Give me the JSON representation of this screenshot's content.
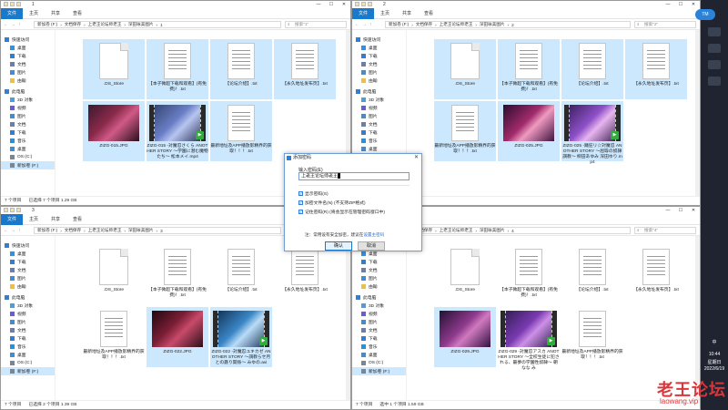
{
  "windows": [
    {
      "title": "1",
      "tabs": [
        "文件",
        "主页",
        "共享",
        "查看"
      ],
      "breadcrumb": [
        "新加卷 (F:)",
        "文档保存",
        "上老王论坛师老王",
        "深田咏美图片",
        "1"
      ],
      "search_placeholder": "搜索\"1\"",
      "status": [
        "7 个项目",
        "已选择 7 个项目 1.29 GB"
      ],
      "nav": [
        {
          "label": "快速访问",
          "icon": "star-icon"
        },
        {
          "label": "桌面",
          "icon": "desktop-icon"
        },
        {
          "label": "下载",
          "icon": "download-icon"
        },
        {
          "label": "文档",
          "icon": "document-icon"
        },
        {
          "label": "图片",
          "icon": "picture-icon"
        },
        {
          "label": "由翰",
          "icon": "folder-icon"
        },
        {
          "label": "此电脑",
          "icon": "computer-icon"
        },
        {
          "label": "3D 对象",
          "icon": "cube-icon"
        },
        {
          "label": "视频",
          "icon": "video-icon"
        },
        {
          "label": "图片",
          "icon": "picture-icon"
        },
        {
          "label": "文档",
          "icon": "document-icon"
        },
        {
          "label": "下载",
          "icon": "download-icon"
        },
        {
          "label": "音乐",
          "icon": "music-icon"
        },
        {
          "label": "桌面",
          "icon": "desktop-icon"
        },
        {
          "label": "OS (C:)",
          "icon": "drive-icon"
        },
        {
          "label": "新加卷 (F:)",
          "icon": "drive-icon",
          "selected": true
        }
      ],
      "items": [
        {
          "label": ".DS_Store",
          "type": "doc",
          "selected": true
        },
        {
          "label": "【本子微超下载和观看】(有免费)！.txt",
          "type": "txt",
          "selected": true
        },
        {
          "label": "【论坛介绍】.txt",
          "type": "txt",
          "selected": true
        },
        {
          "label": "【永久地址发布页】.txt",
          "type": "txt",
          "selected": true
        },
        {
          "label": "ZIZG-015.JPG",
          "type": "pic",
          "selected": true
        },
        {
          "label": "ZIZG-015 -对魔忍さくら ANOTHER STORY ～学園に潜む魔物たち～ 松本メイ.mp4",
          "type": "vid",
          "selected": true
        },
        {
          "label": "最新地址及APP播放影精界的获取！！！.txt",
          "type": "txt",
          "selected": true
        }
      ]
    },
    {
      "title": "2",
      "tabs": [
        "文件",
        "主页",
        "共享",
        "查看"
      ],
      "breadcrumb": [
        "新加卷 (F:)",
        "文档保存",
        "上老王论坛师老王",
        "深田咏美图片",
        "2"
      ],
      "search_placeholder": "搜索\"2\"",
      "status": [
        "7 个项目",
        "已选择 7 个项目"
      ],
      "nav": [
        {
          "label": "快速访问",
          "icon": "star-icon"
        },
        {
          "label": "桌面",
          "icon": "desktop-icon"
        },
        {
          "label": "下载",
          "icon": "download-icon"
        },
        {
          "label": "文档",
          "icon": "document-icon"
        },
        {
          "label": "图片",
          "icon": "picture-icon"
        },
        {
          "label": "由翰",
          "icon": "folder-icon"
        },
        {
          "label": "此电脑",
          "icon": "computer-icon"
        },
        {
          "label": "3D 对象",
          "icon": "cube-icon"
        },
        {
          "label": "视频",
          "icon": "video-icon"
        },
        {
          "label": "图片",
          "icon": "picture-icon"
        },
        {
          "label": "文档",
          "icon": "document-icon"
        },
        {
          "label": "下载",
          "icon": "download-icon"
        },
        {
          "label": "音乐",
          "icon": "music-icon"
        },
        {
          "label": "桌面",
          "icon": "desktop-icon"
        },
        {
          "label": "OS (C:)",
          "icon": "drive-icon"
        },
        {
          "label": "新加卷 (F:)",
          "icon": "drive-icon",
          "selected": true
        }
      ],
      "items": [
        {
          "label": ".DS_Store",
          "type": "doc",
          "selected": true
        },
        {
          "label": "【本子微超下载和观看】(有免费)！.txt",
          "type": "txt",
          "selected": true
        },
        {
          "label": "【论坛介绍】.txt",
          "type": "txt",
          "selected": true
        },
        {
          "label": "【永久地址发布页】.txt",
          "type": "txt",
          "selected": true
        },
        {
          "label": "最新地址及APP播放影精界的获取！！！.txt",
          "type": "txt",
          "selected": true
        },
        {
          "label": "ZIZG-025.JPG",
          "type": "pic",
          "selected": true
        },
        {
          "label": "ZIZG-025 -踊狂リ☆対魔忍 ANOTHER STORY ～屈辱の奴隷調教～ 柳田あゆみ 深田ゆり.mp4",
          "type": "vid",
          "selected": true
        }
      ]
    },
    {
      "title": "3",
      "tabs": [
        "文件",
        "主页",
        "共享",
        "查看"
      ],
      "breadcrumb": [
        "新加卷 (F:)",
        "文档保存",
        "上老王论坛师老王",
        "深田咏美图片",
        "3"
      ],
      "search_placeholder": "搜索\"3\"",
      "status": [
        "7 个项目",
        "已选择 2 个项目 1.39 GB"
      ],
      "nav": [
        {
          "label": "快速访问",
          "icon": "star-icon"
        },
        {
          "label": "桌面",
          "icon": "desktop-icon"
        },
        {
          "label": "下载",
          "icon": "download-icon"
        },
        {
          "label": "文档",
          "icon": "document-icon"
        },
        {
          "label": "图片",
          "icon": "picture-icon"
        },
        {
          "label": "由翰",
          "icon": "folder-icon"
        },
        {
          "label": "此电脑",
          "icon": "computer-icon"
        },
        {
          "label": "3D 对象",
          "icon": "cube-icon"
        },
        {
          "label": "视频",
          "icon": "video-icon"
        },
        {
          "label": "图片",
          "icon": "picture-icon"
        },
        {
          "label": "文档",
          "icon": "document-icon"
        },
        {
          "label": "下载",
          "icon": "download-icon"
        },
        {
          "label": "音乐",
          "icon": "music-icon"
        },
        {
          "label": "桌面",
          "icon": "desktop-icon"
        },
        {
          "label": "OS (C:)",
          "icon": "drive-icon"
        },
        {
          "label": "新加卷 (F:)",
          "icon": "drive-icon",
          "selected": true
        }
      ],
      "items": [
        {
          "label": ".DS_Store",
          "type": "doc",
          "selected": false
        },
        {
          "label": "【本子微超下载和观看】(有免费)！.txt",
          "type": "txt",
          "selected": false
        },
        {
          "label": "【论坛介绍】.txt",
          "type": "txt",
          "selected": false
        },
        {
          "label": "【永久地址发布页】.txt",
          "type": "txt",
          "selected": false
        },
        {
          "label": "最新地址及APP播放影精界的获取！！！.txt",
          "type": "txt",
          "selected": false
        },
        {
          "label": "ZIZG-022.JPG",
          "type": "pic",
          "selected": true
        },
        {
          "label": "ZIZG-022 -対魔忍ユキカゼ ANOTHER STORY ～調教らせ月との姦り関係～ みゆの.avi",
          "type": "vid",
          "selected": true
        }
      ]
    },
    {
      "title": "4",
      "tabs": [
        "文件",
        "主页",
        "共享",
        "查看"
      ],
      "context_tab": "管理",
      "context_tool": "图片工具",
      "breadcrumb": [
        "新加卷 (F:)",
        "文档保存",
        "上老王论坛师老王",
        "深田咏美图片",
        "4"
      ],
      "search_placeholder": "搜索\"4\"",
      "status": [
        "7 个项目",
        "选中 1 个项目 1.59 GB"
      ],
      "nav": [
        {
          "label": "快速访问",
          "icon": "star-icon"
        },
        {
          "label": "桌面",
          "icon": "desktop-icon"
        },
        {
          "label": "下载",
          "icon": "download-icon"
        },
        {
          "label": "文档",
          "icon": "document-icon"
        },
        {
          "label": "图片",
          "icon": "picture-icon"
        },
        {
          "label": "由翰",
          "icon": "folder-icon"
        },
        {
          "label": "此电脑",
          "icon": "computer-icon"
        },
        {
          "label": "3D 对象",
          "icon": "cube-icon"
        },
        {
          "label": "视频",
          "icon": "video-icon"
        },
        {
          "label": "图片",
          "icon": "picture-icon"
        },
        {
          "label": "文档",
          "icon": "document-icon"
        },
        {
          "label": "下载",
          "icon": "download-icon"
        },
        {
          "label": "音乐",
          "icon": "music-icon"
        },
        {
          "label": "桌面",
          "icon": "desktop-icon"
        },
        {
          "label": "OS (C:)",
          "icon": "drive-icon"
        },
        {
          "label": "新加卷 (F:)",
          "icon": "drive-icon",
          "selected": true
        }
      ],
      "items": [
        {
          "label": ".DS_Store",
          "type": "doc",
          "selected": false
        },
        {
          "label": "【本子微超下载和观看】(有免费)！.txt",
          "type": "txt",
          "selected": false
        },
        {
          "label": "【论坛介绍】.txt",
          "type": "txt",
          "selected": false
        },
        {
          "label": "【永久地址发布页】.txt",
          "type": "txt",
          "selected": false
        },
        {
          "label": "ZIZG-029.JPG",
          "type": "pic",
          "selected": true
        },
        {
          "label": "ZIZG-029 -対魔忍アスカ ANOTHER STORY ～全校生徒に犯される、最夢の学園性奴隷～ 朝なな み",
          "type": "vid",
          "selected": false
        },
        {
          "label": "最新地址及APP播放影精界的获取！！！.txt",
          "type": "txt",
          "selected": false
        }
      ]
    }
  ],
  "dialog": {
    "title": "添加密码",
    "password_label": "输入密码(E)",
    "password_value": "上老王论坛师老王",
    "options": [
      {
        "label": "显示密码(S)",
        "checked": true
      },
      {
        "label": "加密文件名(N) (不支持ZIP格式)",
        "checked": true
      },
      {
        "label": "记住密码(R) (将会显示在管理密码窗口中)",
        "checked": true
      }
    ],
    "note_prefix": "注：常用设有安全加密，建议在",
    "note_link": "设置主密码",
    "ok_label": "确认",
    "cancel_label": "取消"
  },
  "tray": {
    "input_method": "中",
    "time": "10:44",
    "weekday": "星期日",
    "date": "2022/6/19",
    "badge": "TM"
  },
  "watermark": {
    "title": "老王论坛",
    "url": "laowang.vip"
  }
}
